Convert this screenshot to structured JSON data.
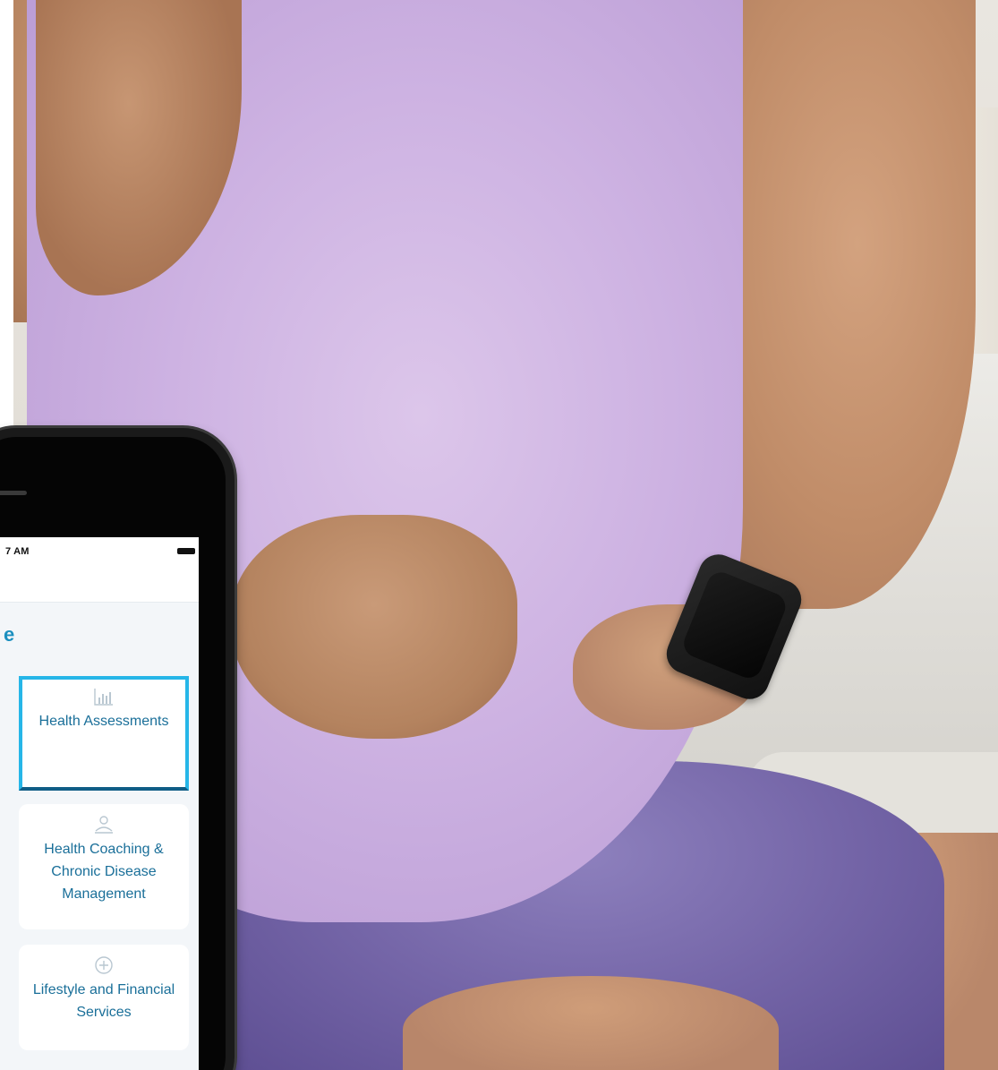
{
  "phone": {
    "status": {
      "time": "7 AM"
    },
    "page": {
      "title": "e"
    },
    "cards": [
      {
        "icon": "bar-chart-icon",
        "label": "Health Assessments"
      },
      {
        "icon": "health-coach-icon",
        "label": "Health Coaching & Chronic Disease Management"
      },
      {
        "icon": "plus-circle-icon",
        "label": "Lifestyle and Financial Services"
      }
    ]
  },
  "colors": {
    "accent": "#1b8fbf",
    "card_text": "#1a6f99",
    "selected_border": "#26b6e8"
  }
}
